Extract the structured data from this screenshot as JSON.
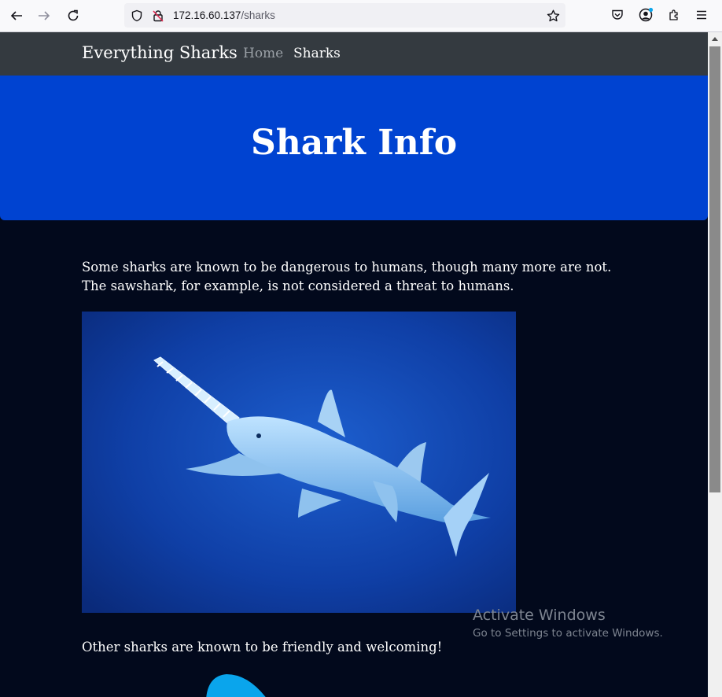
{
  "browser": {
    "url_host": "172.16.60.137",
    "url_path": "/sharks",
    "icons": [
      "back-arrow-icon",
      "forward-arrow-icon",
      "reload-icon",
      "shield-icon",
      "insecure-lock-icon",
      "star-icon",
      "pocket-icon",
      "account-icon",
      "extensions-icon",
      "menu-icon"
    ]
  },
  "navbar": {
    "brand": "Everything Sharks",
    "links": [
      {
        "label": "Home",
        "active": false
      },
      {
        "label": "Sharks",
        "active": true
      }
    ]
  },
  "hero": {
    "title": "Shark Info"
  },
  "content": {
    "paragraph1": "Some sharks are known to be dangerous to humans, though many more are not. The sawshark, for example, is not considered a threat to humans.",
    "paragraph2": "Other sharks are known to be friendly and welcoming!"
  },
  "watermark": {
    "title": "Activate Windows",
    "subtitle": "Go to Settings to activate Windows."
  },
  "colors": {
    "navbar_bg": "#343a40",
    "hero_bg": "#0043d1",
    "page_bg": "#02091c",
    "nav_inactive": "#9aa0a6"
  }
}
